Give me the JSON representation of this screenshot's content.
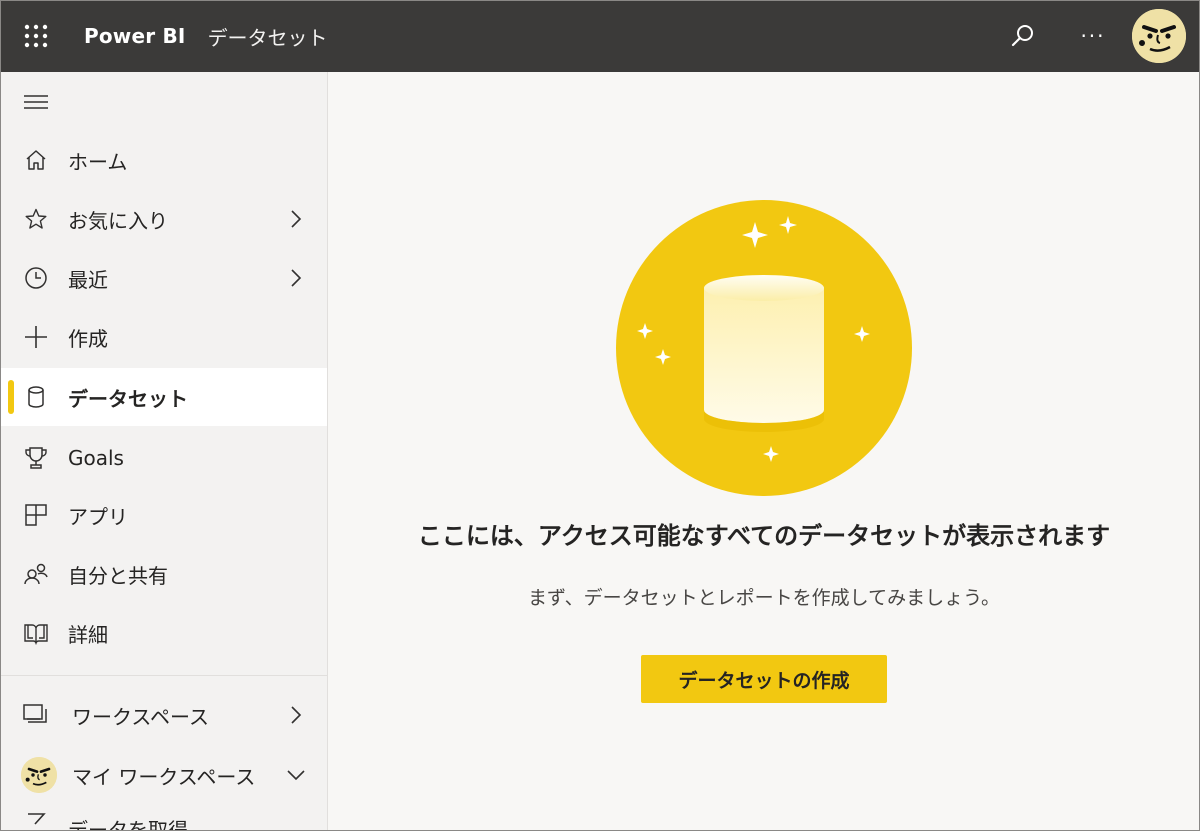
{
  "topbar": {
    "brand": "Power BI",
    "breadcrumb": "データセット",
    "more_label": "···"
  },
  "sidebar": {
    "items": [
      {
        "label": "ホーム",
        "icon": "home-icon"
      },
      {
        "label": "お気に入り",
        "icon": "star-icon"
      },
      {
        "label": "最近",
        "icon": "clock-icon"
      },
      {
        "label": "作成",
        "icon": "plus-icon"
      },
      {
        "label": "データセット",
        "icon": "database-icon"
      },
      {
        "label": "Goals",
        "icon": "trophy-icon"
      },
      {
        "label": "アプリ",
        "icon": "apps-icon"
      },
      {
        "label": "自分と共有",
        "icon": "shared-people-icon"
      },
      {
        "label": "詳細",
        "icon": "book-icon"
      },
      {
        "label": "ワークスペース",
        "icon": "workspaces-icon"
      },
      {
        "label": "マイ ワークスペース",
        "icon": "avatar"
      }
    ],
    "get_data_label": "データを取得"
  },
  "main": {
    "headline": "ここには、アクセス可能なすべてのデータセットが表示されます",
    "subtext": "まず、データセットとレポートを作成してみましょう。",
    "cta_label": "データセットの作成"
  },
  "colors": {
    "topbar": "#3b3a39",
    "accent": "#f2c811",
    "sidebar": "#f3f2f1",
    "main_bg": "#f8f7f5"
  }
}
